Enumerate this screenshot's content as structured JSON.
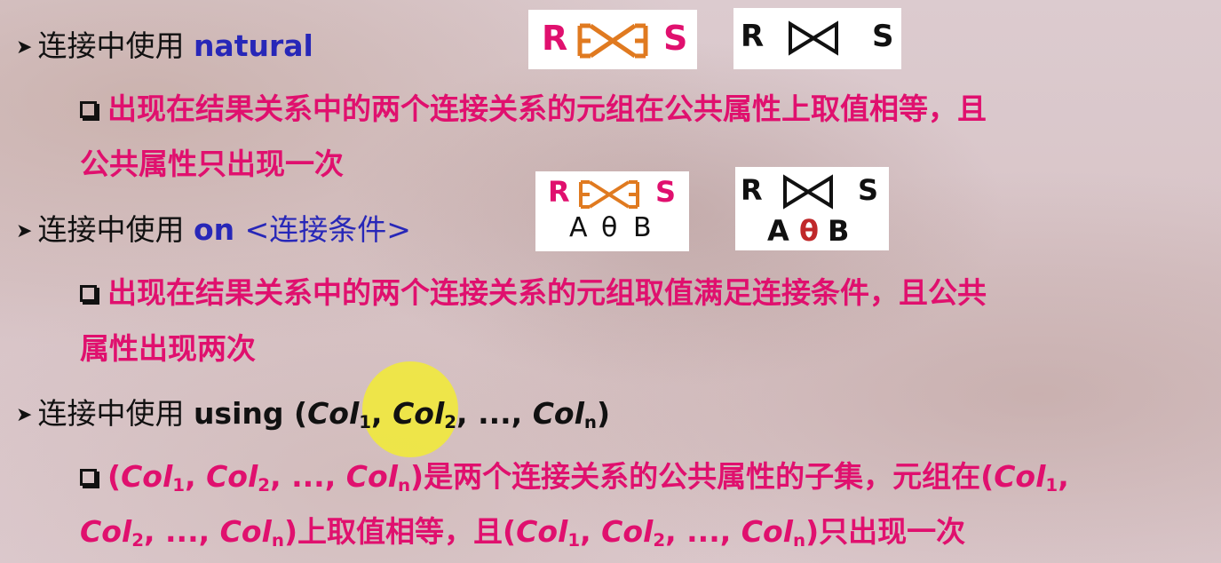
{
  "bullets": [
    {
      "prefix": "连接中使用 ",
      "keyword": "natural"
    },
    {
      "prefix": "连接中使用 ",
      "keyword_on": "on ",
      "keyword_cond": "<连接条件>"
    },
    {
      "prefix": "连接中使用 ",
      "keyword_using": "using (",
      "col": "Col",
      "s1": "1",
      "sep": ", ",
      "s2": "2",
      "dots": ", ..., ",
      "sn": "n",
      "close": ")"
    }
  ],
  "sub1": {
    "line1": "出现在结果关系中的两个连接关系的元组在公共属性上取值相等，且",
    "line2": "公共属性只出现一次"
  },
  "sub2": {
    "line1": "出现在结果关系中的两个连接关系的元组取值满足连接条件，且公共",
    "line2": "属性出现两次"
  },
  "sub3": {
    "open": "(",
    "col": "Col",
    "s1": "1",
    "comma": ", ",
    "s2": "2",
    "dots": ", ..., ",
    "sn": "n",
    "close": ")",
    "mid1": "是两个连接关系的公共属性的子集，元组在",
    "mid2": "上取值相等，且",
    "tail": "只出现一次"
  },
  "symbols": {
    "r": "R",
    "s": "S",
    "cond_a": "A",
    "cond_theta": "θ",
    "cond_b": "B"
  },
  "colors": {
    "pink": "#e0106e",
    "blue": "#2727b8",
    "orange": "#e07a20",
    "theta_red": "#c0282a"
  }
}
